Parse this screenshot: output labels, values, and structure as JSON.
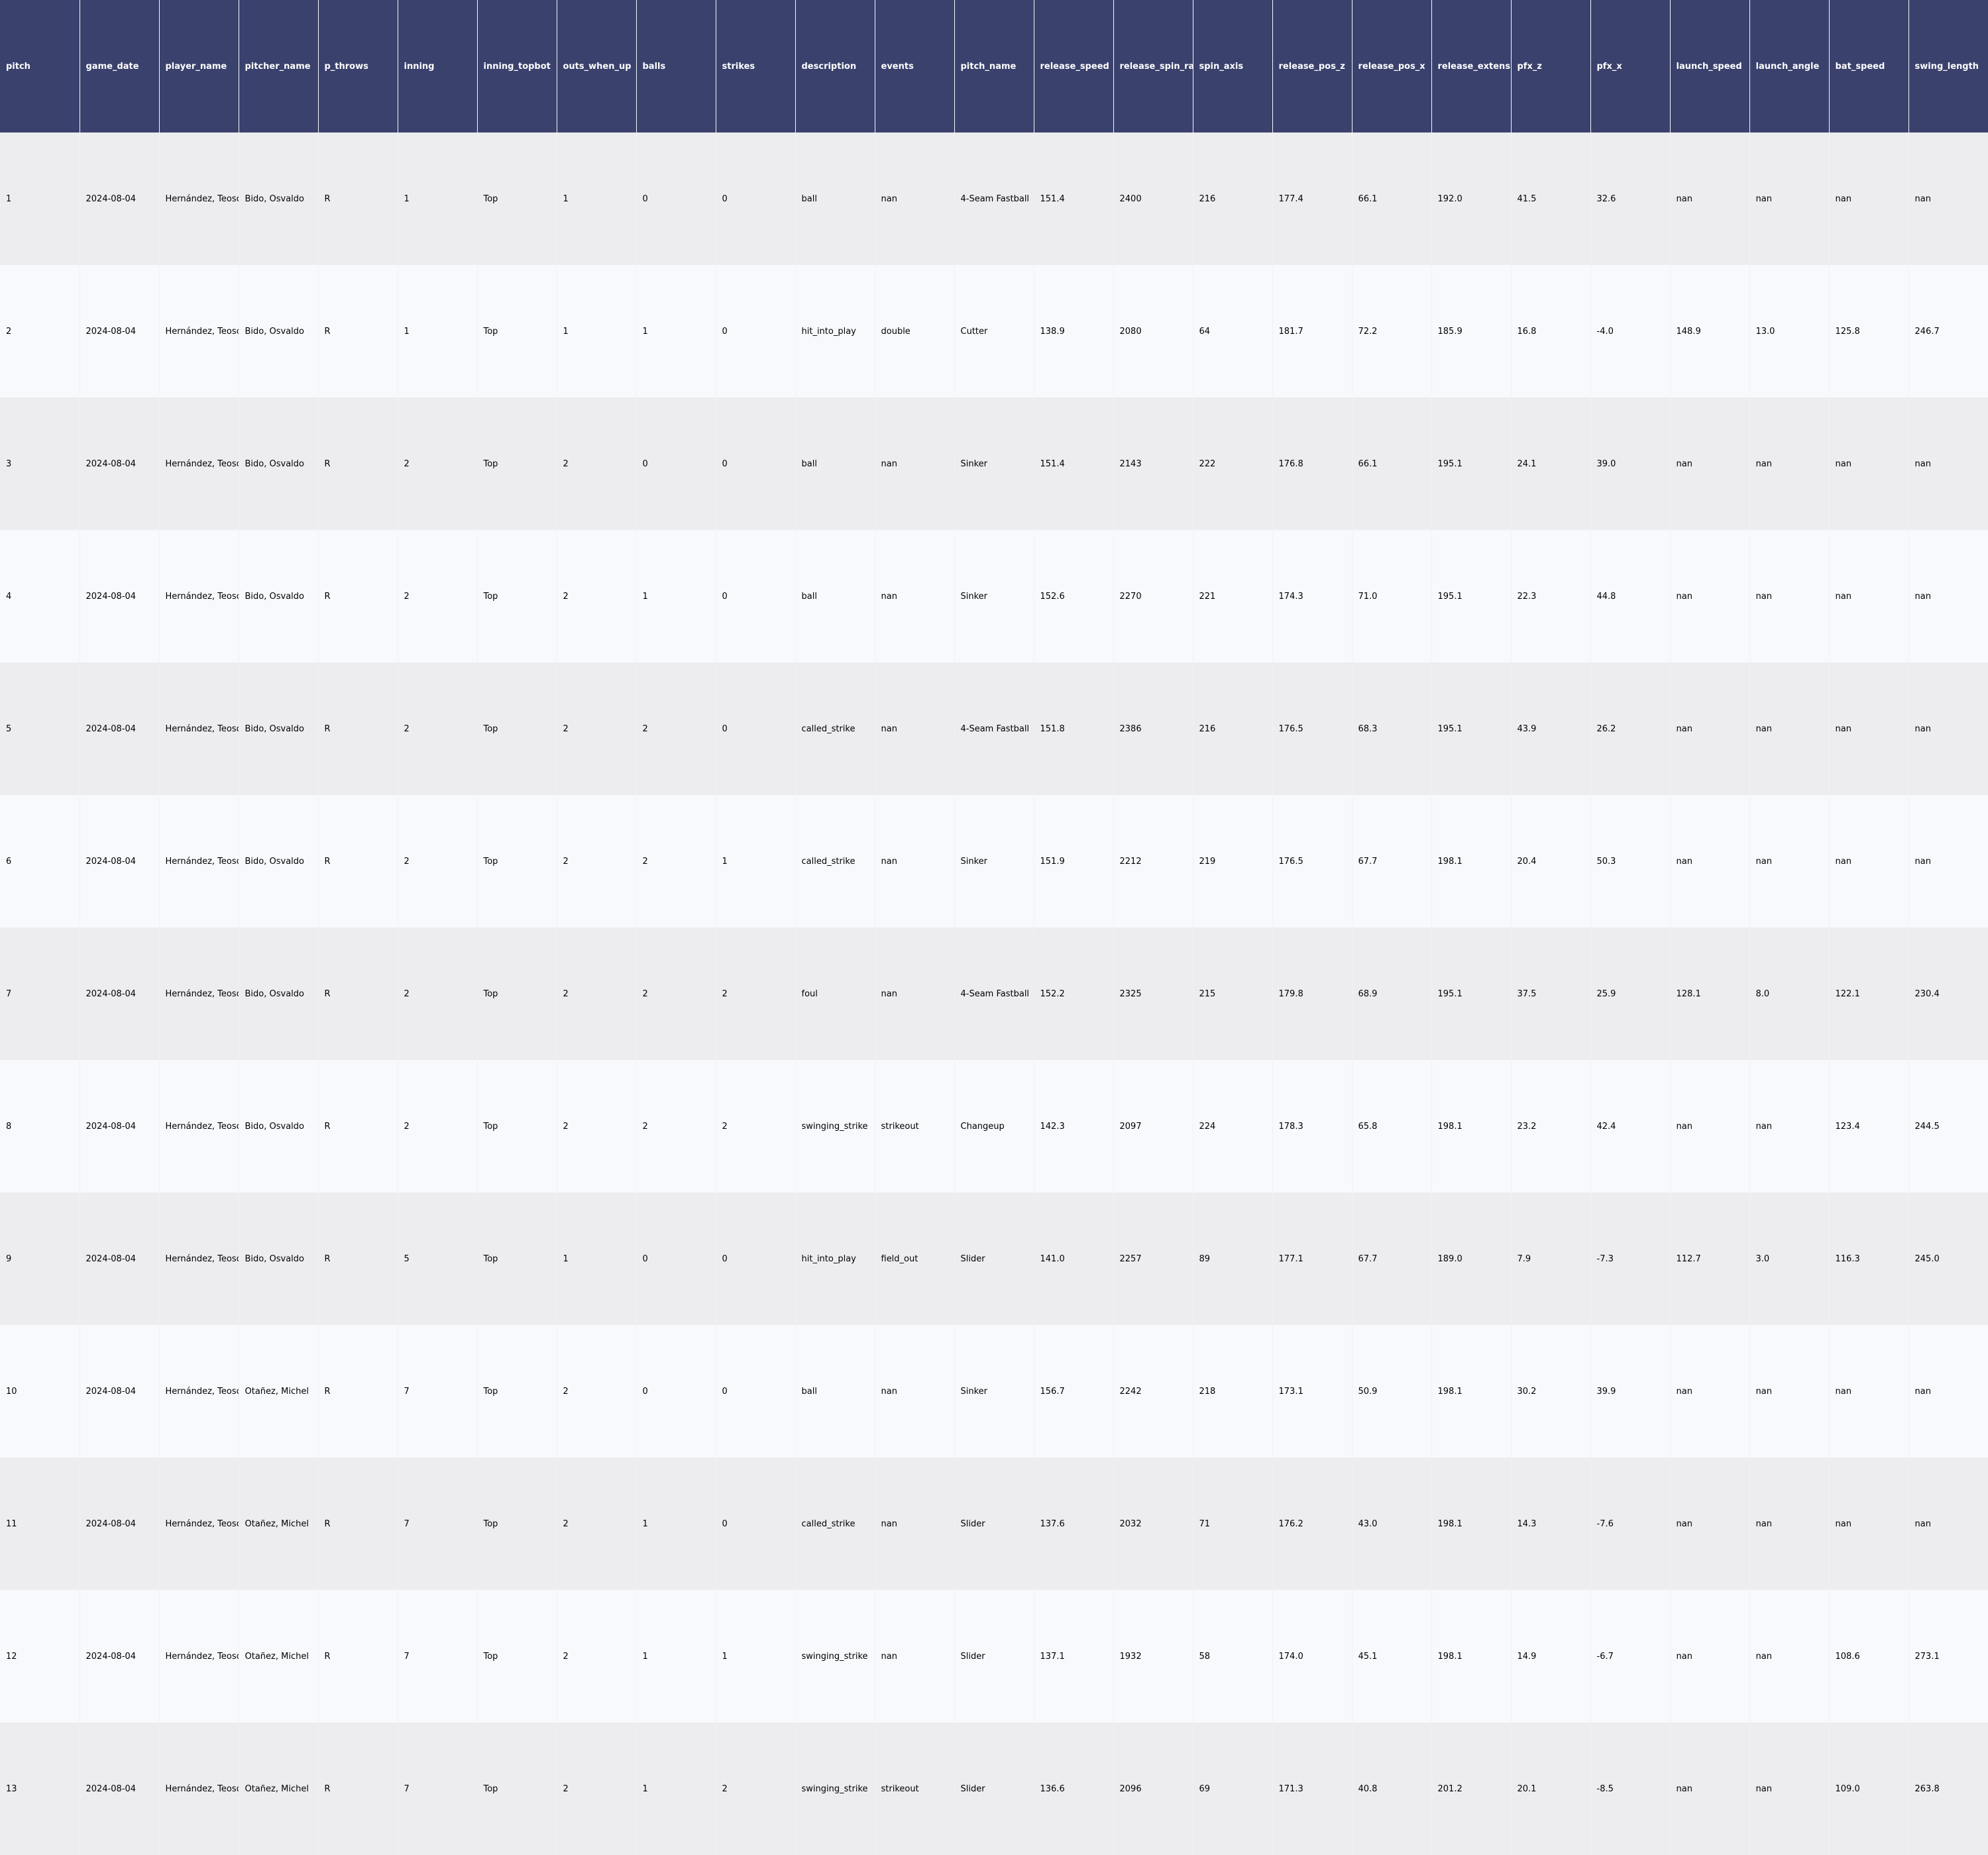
{
  "table": {
    "columns": [
      "pitch",
      "game_date",
      "player_name",
      "pitcher_name",
      "p_throws",
      "inning",
      "inning_topbot",
      "outs_when_up",
      "balls",
      "strikes",
      "description",
      "events",
      "pitch_name",
      "release_speed",
      "release_spin_rate",
      "spin_axis",
      "release_pos_z",
      "release_pos_x",
      "release_extension",
      "pfx_z",
      "pfx_x",
      "launch_speed",
      "launch_angle",
      "bat_speed",
      "swing_length"
    ],
    "rows": [
      [
        "1",
        "2024-08-04",
        "Hernández, Teoscar",
        "Bido, Osvaldo",
        "R",
        "1",
        "Top",
        "1",
        "0",
        "0",
        "ball",
        "nan",
        "4-Seam Fastball",
        "151.4",
        "2400",
        "216",
        "177.4",
        "66.1",
        "192.0",
        "41.5",
        "32.6",
        "nan",
        "nan",
        "nan",
        "nan"
      ],
      [
        "2",
        "2024-08-04",
        "Hernández, Teoscar",
        "Bido, Osvaldo",
        "R",
        "1",
        "Top",
        "1",
        "1",
        "0",
        "hit_into_play",
        "double",
        "Cutter",
        "138.9",
        "2080",
        "64",
        "181.7",
        "72.2",
        "185.9",
        "16.8",
        "-4.0",
        "148.9",
        "13.0",
        "125.8",
        "246.7"
      ],
      [
        "3",
        "2024-08-04",
        "Hernández, Teoscar",
        "Bido, Osvaldo",
        "R",
        "2",
        "Top",
        "2",
        "0",
        "0",
        "ball",
        "nan",
        "Sinker",
        "151.4",
        "2143",
        "222",
        "176.8",
        "66.1",
        "195.1",
        "24.1",
        "39.0",
        "nan",
        "nan",
        "nan",
        "nan"
      ],
      [
        "4",
        "2024-08-04",
        "Hernández, Teoscar",
        "Bido, Osvaldo",
        "R",
        "2",
        "Top",
        "2",
        "1",
        "0",
        "ball",
        "nan",
        "Sinker",
        "152.6",
        "2270",
        "221",
        "174.3",
        "71.0",
        "195.1",
        "22.3",
        "44.8",
        "nan",
        "nan",
        "nan",
        "nan"
      ],
      [
        "5",
        "2024-08-04",
        "Hernández, Teoscar",
        "Bido, Osvaldo",
        "R",
        "2",
        "Top",
        "2",
        "2",
        "0",
        "called_strike",
        "nan",
        "4-Seam Fastball",
        "151.8",
        "2386",
        "216",
        "176.5",
        "68.3",
        "195.1",
        "43.9",
        "26.2",
        "nan",
        "nan",
        "nan",
        "nan"
      ],
      [
        "6",
        "2024-08-04",
        "Hernández, Teoscar",
        "Bido, Osvaldo",
        "R",
        "2",
        "Top",
        "2",
        "2",
        "1",
        "called_strike",
        "nan",
        "Sinker",
        "151.9",
        "2212",
        "219",
        "176.5",
        "67.7",
        "198.1",
        "20.4",
        "50.3",
        "nan",
        "nan",
        "nan",
        "nan"
      ],
      [
        "7",
        "2024-08-04",
        "Hernández, Teoscar",
        "Bido, Osvaldo",
        "R",
        "2",
        "Top",
        "2",
        "2",
        "2",
        "foul",
        "nan",
        "4-Seam Fastball",
        "152.2",
        "2325",
        "215",
        "179.8",
        "68.9",
        "195.1",
        "37.5",
        "25.9",
        "128.1",
        "8.0",
        "122.1",
        "230.4"
      ],
      [
        "8",
        "2024-08-04",
        "Hernández, Teoscar",
        "Bido, Osvaldo",
        "R",
        "2",
        "Top",
        "2",
        "2",
        "2",
        "swinging_strike",
        "strikeout",
        "Changeup",
        "142.3",
        "2097",
        "224",
        "178.3",
        "65.8",
        "198.1",
        "23.2",
        "42.4",
        "nan",
        "nan",
        "123.4",
        "244.5"
      ],
      [
        "9",
        "2024-08-04",
        "Hernández, Teoscar",
        "Bido, Osvaldo",
        "R",
        "5",
        "Top",
        "1",
        "0",
        "0",
        "hit_into_play",
        "field_out",
        "Slider",
        "141.0",
        "2257",
        "89",
        "177.1",
        "67.7",
        "189.0",
        "7.9",
        "-7.3",
        "112.7",
        "3.0",
        "116.3",
        "245.0"
      ],
      [
        "10",
        "2024-08-04",
        "Hernández, Teoscar",
        "Otañez, Michel",
        "R",
        "7",
        "Top",
        "2",
        "0",
        "0",
        "ball",
        "nan",
        "Sinker",
        "156.7",
        "2242",
        "218",
        "173.1",
        "50.9",
        "198.1",
        "30.2",
        "39.9",
        "nan",
        "nan",
        "nan",
        "nan"
      ],
      [
        "11",
        "2024-08-04",
        "Hernández, Teoscar",
        "Otañez, Michel",
        "R",
        "7",
        "Top",
        "2",
        "1",
        "0",
        "called_strike",
        "nan",
        "Slider",
        "137.6",
        "2032",
        "71",
        "176.2",
        "43.0",
        "198.1",
        "14.3",
        "-7.6",
        "nan",
        "nan",
        "nan",
        "nan"
      ],
      [
        "12",
        "2024-08-04",
        "Hernández, Teoscar",
        "Otañez, Michel",
        "R",
        "7",
        "Top",
        "2",
        "1",
        "1",
        "swinging_strike",
        "nan",
        "Slider",
        "137.1",
        "1932",
        "58",
        "174.0",
        "45.1",
        "198.1",
        "14.9",
        "-6.7",
        "nan",
        "nan",
        "108.6",
        "273.1"
      ],
      [
        "13",
        "2024-08-04",
        "Hernández, Teoscar",
        "Otañez, Michel",
        "R",
        "7",
        "Top",
        "2",
        "1",
        "2",
        "swinging_strike",
        "strikeout",
        "Slider",
        "136.6",
        "2096",
        "69",
        "171.3",
        "40.8",
        "201.2",
        "20.1",
        "-8.5",
        "nan",
        "nan",
        "109.0",
        "263.8"
      ]
    ]
  },
  "colors": {
    "header_bg": "#3a416c",
    "header_text": "#ffffff",
    "row_odd": "#ededf0",
    "row_even": "#f8f9fc"
  }
}
